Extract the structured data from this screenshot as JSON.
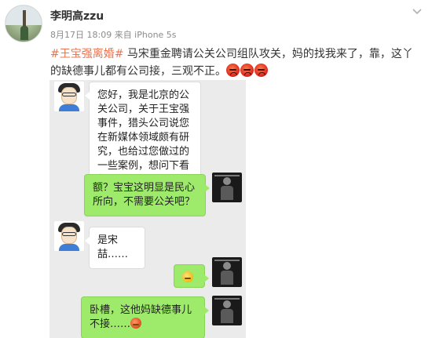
{
  "post": {
    "username": "李明高zzu",
    "meta": "8月17日 18:09 来自 iPhone 5s",
    "hashtag": "#王宝强离婚#",
    "text": " 马宋重金聘请公关公司组队攻关，妈的找我来了，靠，这丫的缺德事儿都有公司接，三观不正。",
    "emoji_count": 3,
    "emoji_icon": "angry-face-icon"
  },
  "chat": {
    "messages": [
      {
        "side": "in",
        "text": "您好，我是北京的公关公司，关于王宝强事件，猎头公司说您在新媒体领域颇有研究，也给过您做过的一些案例，想问下看怎么合作？"
      },
      {
        "side": "out",
        "text": "额？宝宝这明显是民心所向，不需要公关吧？"
      },
      {
        "side": "in",
        "text": "是宋喆……"
      },
      {
        "side": "out",
        "text": "",
        "sticker": "grin-emoji-icon"
      },
      {
        "side": "out",
        "text": "卧槽，这他妈缺德事儿不接……",
        "sticker": "angry-emoji-icon"
      }
    ]
  },
  "colors": {
    "hashtag": "#eb7350",
    "bubble_out": "#9eea6a",
    "bubble_in": "#ffffff",
    "chat_bg": "#ebebeb"
  }
}
